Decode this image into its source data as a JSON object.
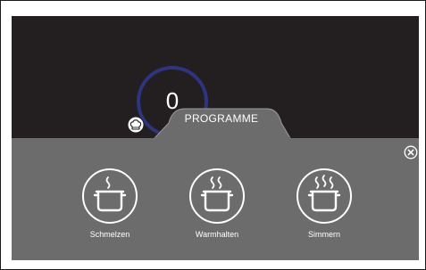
{
  "dial": {
    "value": "0"
  },
  "panel": {
    "tab_label": "PROGRAMME",
    "programs": [
      {
        "label": "Schmelzen",
        "steam_level": 1
      },
      {
        "label": "Warmhalten",
        "steam_level": 2
      },
      {
        "label": "Simmern",
        "steam_level": 3
      }
    ]
  },
  "colors": {
    "screen_bg": "#231f20",
    "panel_bg": "#6c6c6c",
    "dial_ring": "#2f3480",
    "text": "#ffffff"
  },
  "icons": {
    "badge": "chef-hat-icon",
    "close": "close-icon",
    "program": "pot-steam-icon"
  }
}
